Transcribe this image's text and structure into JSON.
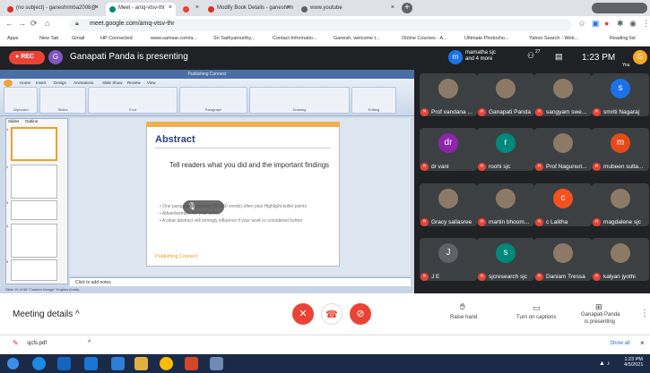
{
  "browser": {
    "tabs": [
      {
        "label": "(no subject) - ganeshrmba2008@",
        "color": "#d93025"
      },
      {
        "label": "Meet - amq-vtsv-thr",
        "color": "#00897b"
      },
      {
        "label": "",
        "color": "#ea4335"
      },
      {
        "label": "Modify Book Details - ganeshrm",
        "color": "#d93025"
      },
      {
        "label": "www.youtube",
        "color": "#5f6368"
      }
    ],
    "url": "meet.google.com/amq-vtsv-thr",
    "bookmarks": [
      "Apps",
      "New Tab",
      "Gmail",
      "HP Connected",
      "www.samsar.com/a...",
      "Sri Sathyamurthy...",
      "Contact Informatio...",
      "Ganesh, welcome t...",
      "Online Courses - A...",
      "Ultimate Photosho...",
      "Yahoo Search - Web...",
      "Reading list"
    ]
  },
  "meet": {
    "rec": "REC",
    "presenter_initial": "G",
    "presenter_text": "Ganapati Panda is presenting",
    "others_initial": "m",
    "others_line1": "mamatha sjc",
    "others_line2": "and 4 more",
    "participant_count": "27",
    "time": "1:23 PM",
    "you_label": "You",
    "you_initial": "G"
  },
  "ppt": {
    "title": "Publishing Connect",
    "tabs": [
      "Home",
      "Insert",
      "Design",
      "Animations",
      "Slide Show",
      "Review",
      "View"
    ],
    "groups": [
      "Clipboard",
      "Slides",
      "Font",
      "Paragraph",
      "Drawing",
      "Editing"
    ],
    "pane_tabs": [
      "Slides",
      "Outline"
    ],
    "thumb_numbers": [
      "1",
      "2",
      "3",
      "4",
      "5"
    ],
    "slide": {
      "heading": "Abstract",
      "subheading": "Tell readers what you did and the important findings",
      "bullets": [
        "One paragraph (between 50-250 words) often plus Highlight bullet points",
        "Advertisement for your article",
        "A clear abstract will strongly influence if your work is considered further"
      ],
      "footer": "Publishing Connect"
    },
    "notes": "Click to add notes",
    "status": "Slide 19 of 58   \"Custom Design\"   English (India)"
  },
  "participants": [
    {
      "name": "Prof vandana ...",
      "initial": "",
      "color": "#3c4043",
      "photo": true
    },
    {
      "name": "Ganapati Panda",
      "initial": "",
      "color": "#3c4043",
      "photo": true
    },
    {
      "name": "sangyam swe...",
      "initial": "",
      "color": "#3c4043",
      "photo": true
    },
    {
      "name": "smriti Nagaraj",
      "initial": "s",
      "color": "#1a73e8"
    },
    {
      "name": "dr vani",
      "initial": "dr",
      "color": "#8e24aa"
    },
    {
      "name": "roohi sjc",
      "initial": "r",
      "color": "#00897b"
    },
    {
      "name": "Prof Nagunuri...",
      "initial": "",
      "color": "#3c4043",
      "photo": true
    },
    {
      "name": "mubeen sulta...",
      "initial": "m",
      "color": "#e64a19"
    },
    {
      "name": "Gracy sallasree",
      "initial": "",
      "color": "#3c4043",
      "photo": true
    },
    {
      "name": "martin bhoom...",
      "initial": "",
      "color": "#3c4043",
      "photo": true
    },
    {
      "name": "c Lalitha",
      "initial": "c",
      "color": "#f4511e"
    },
    {
      "name": "magdalene sjc",
      "initial": "",
      "color": "#3c4043",
      "photo": true
    },
    {
      "name": "J E",
      "initial": "J",
      "color": "#5f6368"
    },
    {
      "name": "sjcresearch sjc",
      "initial": "s",
      "color": "#00897b"
    },
    {
      "name": "Daniam Tressa",
      "initial": "",
      "color": "#3c4043",
      "photo": true
    },
    {
      "name": "kalyan jyothi",
      "initial": "",
      "color": "#43a047",
      "photo": true
    }
  ],
  "controls": {
    "meeting_details": "Meeting details",
    "raise_hand": "Raise hand",
    "captions": "Turn on captions",
    "presenting_line1": "Ganapati Panda",
    "presenting_line2": "is presenting"
  },
  "download": {
    "file": "sjcfs.pdf",
    "show_all": "Show all"
  },
  "taskbar": {
    "time": "1:23 PM",
    "date": "4/5/2021"
  }
}
